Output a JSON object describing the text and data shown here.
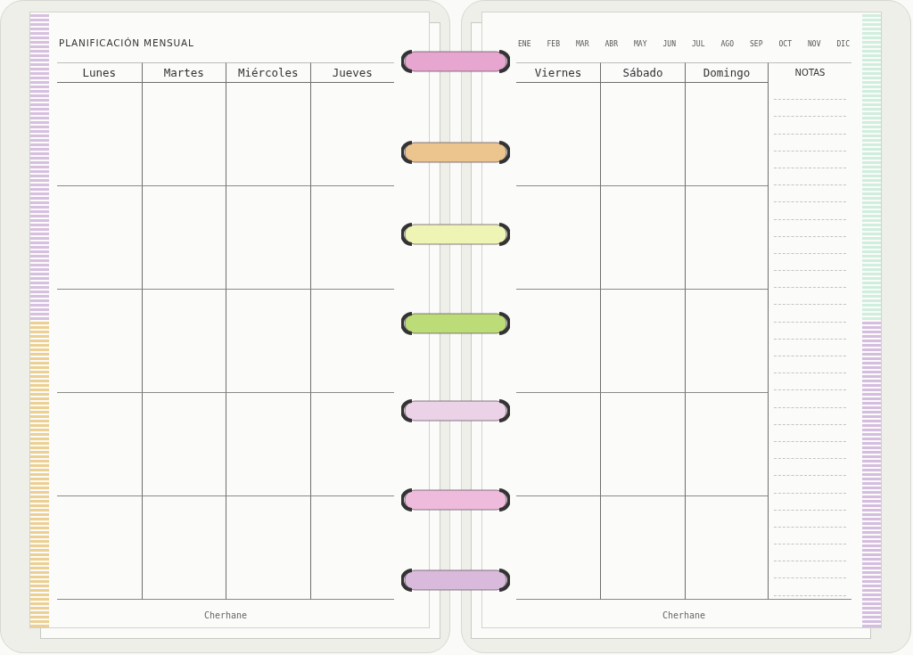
{
  "left_page": {
    "title": "PLANIFICACIÓN MENSUAL",
    "days": [
      "Lunes",
      "Martes",
      "Miércoles",
      "Jueves"
    ],
    "footer": "Cherhane"
  },
  "right_page": {
    "months": [
      "ENE",
      "FEB",
      "MAR",
      "ABR",
      "MAY",
      "JUN",
      "JUL",
      "AGO",
      "SEP",
      "OCT",
      "NOV",
      "DIC"
    ],
    "days": [
      "Viernes",
      "Sábado",
      "Domingo"
    ],
    "notes_label": "NOTAS",
    "footer": "Cherhane"
  },
  "rings": [
    {
      "color": "#e6a6d0"
    },
    {
      "color": "#ebc48e"
    },
    {
      "color": "#eef5b4"
    },
    {
      "color": "#bcdc78"
    },
    {
      "color": "#ecd2e6"
    },
    {
      "color": "#efbbdd"
    },
    {
      "color": "#d9b9dc"
    }
  ]
}
